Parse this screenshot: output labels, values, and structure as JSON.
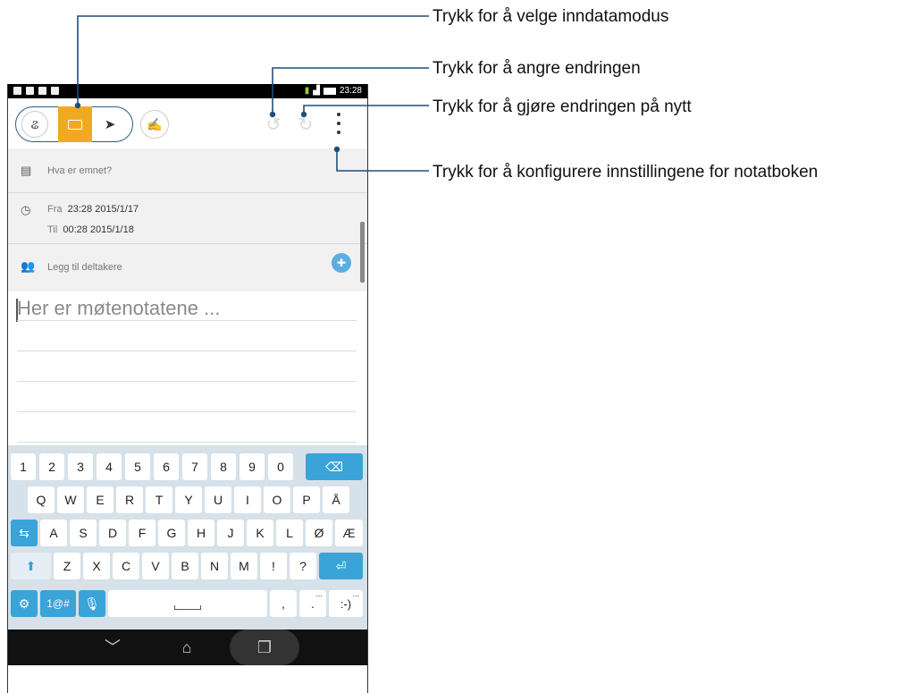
{
  "callouts": {
    "input_mode": "Trykk for å velge inndatamodus",
    "undo": "Trykk for å angre endringen",
    "redo": "Trykk for å gjøre endringen på nytt",
    "settings": "Trykk for å konfigurere innstillingene for notatboken"
  },
  "status_bar": {
    "time": "23:28"
  },
  "toolbar": {
    "mode_icons": [
      "handwriting-icon",
      "keyboard-icon",
      "pen-icon"
    ],
    "selected_mode": "keyboard",
    "colors": {
      "selected": "#f2a922",
      "group_border": "#2b5d8a"
    }
  },
  "meeting": {
    "subject_placeholder": "Hva er emnet?",
    "from_label": "Fra",
    "from_value": "23:28 2015/1/17",
    "to_label": "Til",
    "to_value": "00:28 2015/1/18",
    "participants_label": "Legg til deltakere"
  },
  "notes": {
    "placeholder": "Her er møtenotatene ..."
  },
  "keyboard": {
    "row1": [
      "1",
      "2",
      "3",
      "4",
      "5",
      "6",
      "7",
      "8",
      "9",
      "0"
    ],
    "row2": [
      "Q",
      "W",
      "E",
      "R",
      "T",
      "Y",
      "U",
      "I",
      "O",
      "P",
      "Å"
    ],
    "row3": [
      "A",
      "S",
      "D",
      "F",
      "G",
      "H",
      "J",
      "K",
      "L",
      "Ø",
      "Æ"
    ],
    "row4": [
      "Z",
      "X",
      "C",
      "V",
      "B",
      "N",
      "M",
      "!",
      "?"
    ],
    "symbols_label": "1@#",
    "comma": ",",
    "period": ".",
    "smiley": ":-)",
    "more_mark": "...",
    "accent_color": "#3aa3d8"
  }
}
